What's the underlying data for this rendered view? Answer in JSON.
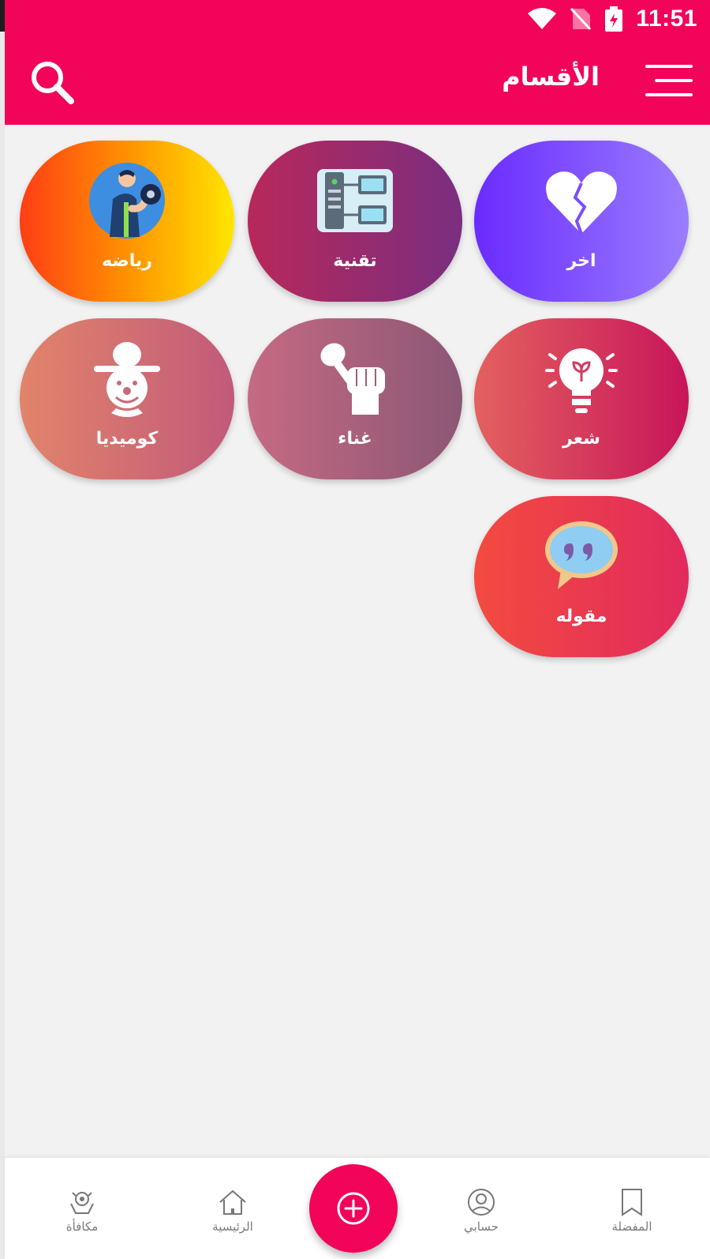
{
  "status_bar": {
    "time": "11:51"
  },
  "header": {
    "title": "الأقسام"
  },
  "colors": {
    "primary": "#f1045a",
    "background": "#f2f2f2"
  },
  "categories": [
    {
      "label": "رياضه",
      "icon": "athlete-dumbbell-icon"
    },
    {
      "label": "تقنية",
      "icon": "server-network-icon"
    },
    {
      "label": "اخر",
      "icon": "broken-heart-icon"
    },
    {
      "label": "كوميديا",
      "icon": "clown-icon"
    },
    {
      "label": "غناء",
      "icon": "microphone-fist-icon"
    },
    {
      "label": "شعر",
      "icon": "idea-bulb-icon"
    },
    {
      "label": "مقوله",
      "icon": "quote-bubble-icon"
    }
  ],
  "bottom_nav": {
    "rewards": "مكافأة",
    "home": "الرئيسية",
    "account": "حسابي",
    "favorites": "المفضلة"
  }
}
